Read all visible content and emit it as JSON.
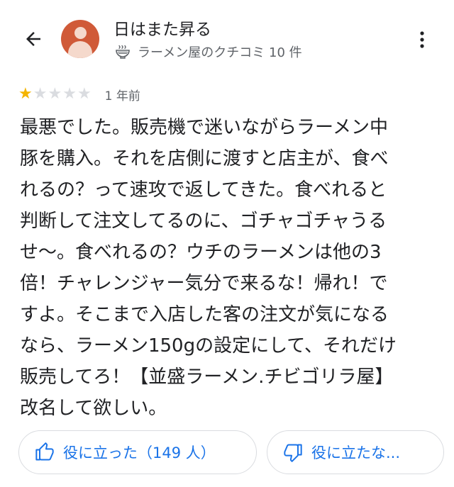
{
  "header": {
    "back_icon": "arrow-back-icon",
    "user_name": "日はまた昇る",
    "meta_icon": "ramen-bowl-icon",
    "meta_text": "ラーメン屋のクチコミ 10 件",
    "more_icon": "more-vert-icon"
  },
  "review": {
    "rating": 1,
    "rating_max": 5,
    "star_filled_color": "#f4b400",
    "star_empty_color": "#dadce0",
    "date": "1 年前",
    "lines": [
      "最悪でした。販売機で迷いながらラーメン中",
      "豚を購入。それを店側に渡すと店主が、食べ",
      "れるの？って速攻で返してきた。食べれると",
      "判断して注文してるのに、ゴチャゴチャうる",
      "せ〜。食べれるの？ウチのラーメンは他の3",
      "倍！チャレンジャー気分で来るな！帰れ！で",
      "すよ。そこまで入店した客の注文が気になる",
      "なら、ラーメン150gの設定にして、それだけ",
      "販売してろ！【並盛ラーメン.チビゴリラ屋】",
      "改名して欲しい。"
    ]
  },
  "actions": {
    "helpful_icon": "thumb-up-icon",
    "helpful_label": "役に立った（149 人）",
    "not_helpful_icon": "thumb-down-icon",
    "not_helpful_label": "役に立たな...",
    "accent_color": "#1a73e8"
  }
}
